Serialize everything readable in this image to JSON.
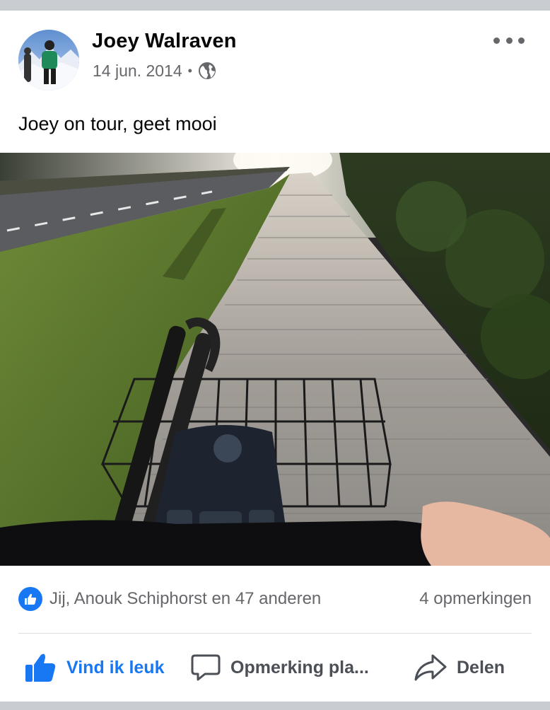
{
  "post": {
    "author": "Joey Walraven",
    "date": "14 jun. 2014",
    "separator": "•",
    "privacy_icon": "globe-icon",
    "text": "Joey on tour, geet mooi",
    "photo_description_icon": "photo"
  },
  "engagement": {
    "reactions_text": "Jij, Anouk Schiphorst en 47 anderen",
    "comments_text": "4 opmerkingen"
  },
  "actions": {
    "like_label": "Vind ik leuk",
    "comment_label": "Opmerking pla...",
    "share_label": "Delen"
  },
  "colors": {
    "accent": "#1877f2",
    "secondary_text": "#65676b",
    "divider": "#dadde1",
    "feed_background": "#c9ccd1"
  }
}
